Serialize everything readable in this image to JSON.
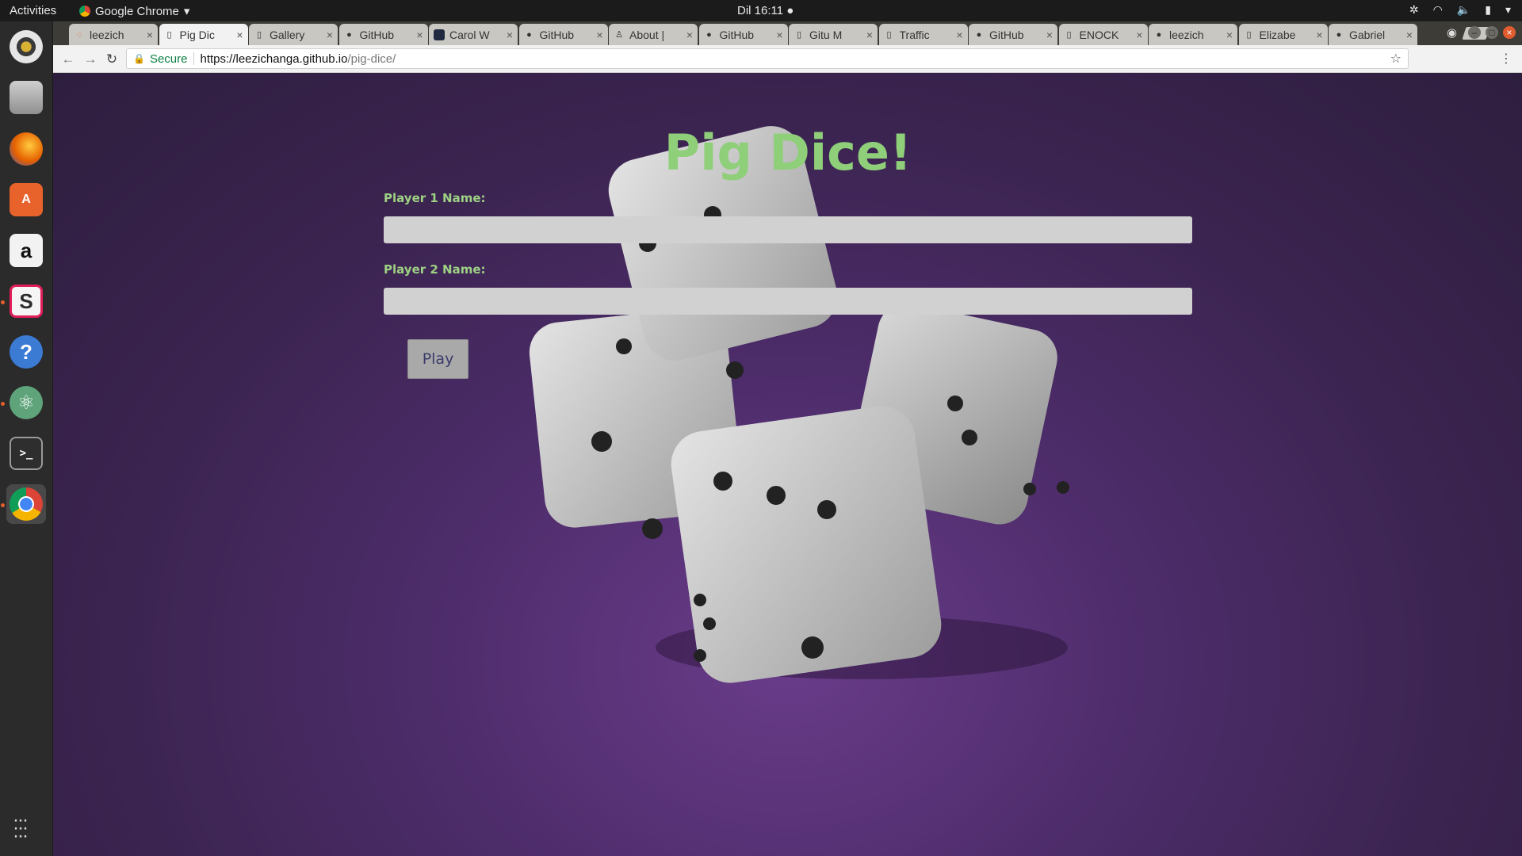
{
  "topbar": {
    "activities": "Activities",
    "app_name": "Google Chrome",
    "clock": "Dil 16:11"
  },
  "dock": {
    "items": [
      "rhythmbox",
      "files",
      "firefox",
      "software",
      "amazon",
      "slack",
      "help",
      "atom",
      "terminal",
      "chrome"
    ]
  },
  "tabs": [
    {
      "title": "leezich",
      "icon": "spinner-icon"
    },
    {
      "title": "Pig Dic",
      "icon": "page-icon"
    },
    {
      "title": "Gallery",
      "icon": "page-icon"
    },
    {
      "title": "GitHub",
      "icon": "github-icon"
    },
    {
      "title": "Carol W",
      "icon": "square-icon"
    },
    {
      "title": "GitHub",
      "icon": "github-icon"
    },
    {
      "title": "About |",
      "icon": "person-icon"
    },
    {
      "title": "GitHub",
      "icon": "github-icon"
    },
    {
      "title": "Gitu M",
      "icon": "page-icon"
    },
    {
      "title": "Traffic",
      "icon": "page-icon"
    },
    {
      "title": "GitHub",
      "icon": "github-icon"
    },
    {
      "title": "ENOCK",
      "icon": "page-icon"
    },
    {
      "title": "leezich",
      "icon": "github-icon"
    },
    {
      "title": "Elizabe",
      "icon": "page-icon"
    },
    {
      "title": "Gabriel",
      "icon": "github-icon"
    }
  ],
  "active_tab_index": 1,
  "omnibox": {
    "secure_label": "Secure",
    "url_host": "https://leezichanga.github.io",
    "url_path": "/pig-dice/"
  },
  "page": {
    "title": "Pig Dice!",
    "player1_label": "Player 1 Name:",
    "player1_value": "",
    "player2_label": "Player 2 Name:",
    "player2_value": "",
    "play_button": "Play"
  },
  "colors": {
    "title_green": "#8fcf7a",
    "background_purple": "#4d2c6a",
    "input_grey": "#d1d1d1",
    "button_grey": "#a9a9a9"
  }
}
